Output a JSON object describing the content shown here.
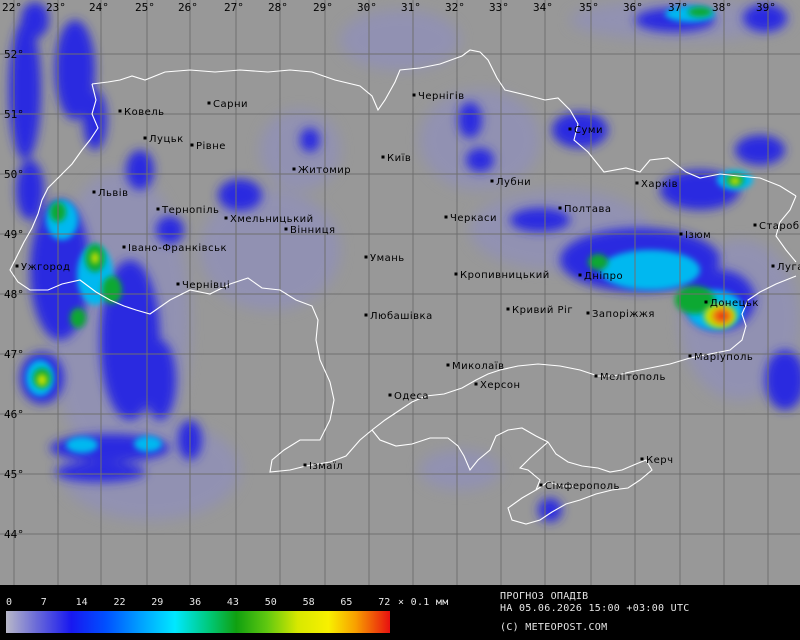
{
  "map": {
    "longitudes": [
      "22°",
      "23°",
      "24°",
      "25°",
      "26°",
      "27°",
      "28°",
      "29°",
      "30°",
      "31°",
      "32°",
      "33°",
      "34°",
      "35°",
      "36°",
      "37°",
      "38°",
      "39°"
    ],
    "latitudes": [
      "52°",
      "51°",
      "50°",
      "49°",
      "48°",
      "47°",
      "46°",
      "45°",
      "44°"
    ],
    "cities": [
      {
        "name": "Ковель"
      },
      {
        "name": "Сарни"
      },
      {
        "name": "Чернігів"
      },
      {
        "name": "Луцьк"
      },
      {
        "name": "Рівне"
      },
      {
        "name": "Суми"
      },
      {
        "name": "Київ"
      },
      {
        "name": "Житомир"
      },
      {
        "name": "Лубни"
      },
      {
        "name": "Харків"
      },
      {
        "name": "Львів"
      },
      {
        "name": "Тернопіль"
      },
      {
        "name": "Хмельницький"
      },
      {
        "name": "Полтава"
      },
      {
        "name": "Черкаси"
      },
      {
        "name": "Вінниця"
      },
      {
        "name": "Старобільськ"
      },
      {
        "name": "Ізюм"
      },
      {
        "name": "Ужгород"
      },
      {
        "name": "Івано-Франківськ"
      },
      {
        "name": "Умань"
      },
      {
        "name": "Луганськ"
      },
      {
        "name": "Кропивницький"
      },
      {
        "name": "Дніпро"
      },
      {
        "name": "Чернівці"
      },
      {
        "name": "Донецьк"
      },
      {
        "name": "Кривий Ріг"
      },
      {
        "name": "Запоріжжя"
      },
      {
        "name": "Любашівка"
      },
      {
        "name": "Маріуполь"
      },
      {
        "name": "Миколаїв"
      },
      {
        "name": "Мелітополь"
      },
      {
        "name": "Херсон"
      },
      {
        "name": "Одеса"
      },
      {
        "name": "Керч"
      },
      {
        "name": "Ізмаїл"
      },
      {
        "name": "Сімферополь"
      }
    ]
  },
  "legend": {
    "ticks": [
      "0",
      "7",
      "14",
      "22",
      "29",
      "36",
      "43",
      "50",
      "58",
      "65",
      "72"
    ],
    "unit": "× 0.1 мм",
    "colors": [
      "#b8b8c0",
      "#6a6ae0",
      "#1818f0",
      "#0050ff",
      "#00a0ff",
      "#00e8ff",
      "#00c870",
      "#10a010",
      "#40c010",
      "#a0d800",
      "#f0f000",
      "#f8b800",
      "#f06010",
      "#e81010"
    ]
  },
  "forecast": {
    "title": "ПРОГНОЗ ОПАДІВ",
    "valid": "НА 05.06.2026 15:00 +03:00 UTC",
    "credit": "(C) METEOPOST.COM"
  },
  "colors": {
    "background": "#989898",
    "grid": "#6f6f6f",
    "border": "#ffffff"
  }
}
